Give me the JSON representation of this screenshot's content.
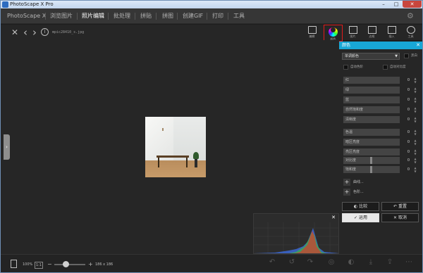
{
  "window": {
    "title": "PhotoScape X Pro",
    "min": "–",
    "max": "□",
    "close": "✕"
  },
  "menu": {
    "items": [
      "PhotoScape X",
      "浏览图片",
      "照片编辑",
      "批处理",
      "拼贴",
      "拼图",
      "创建GIF",
      "打印",
      "工具"
    ],
    "active_index": 2,
    "settings_icon": "gear-icon"
  },
  "toolbar": {
    "close_icon": "✕",
    "prev_icon": "‹",
    "next_icon": "›",
    "info_icon": "i",
    "filename": "mpic28410_s.jpg"
  },
  "right_tools": [
    {
      "label": "编辑",
      "icon": "edit-icon"
    },
    {
      "label": "颜色",
      "icon": "color-ring-icon",
      "selected": true
    },
    {
      "label": "图片",
      "icon": "image-icon"
    },
    {
      "label": "边框",
      "icon": "frame-icon"
    },
    {
      "label": "插入",
      "icon": "insert-icon"
    },
    {
      "label": "工具",
      "icon": "tools-icon"
    }
  ],
  "panel": {
    "title": "颜色",
    "close_icon": "✕",
    "mode_select": "单调颜色",
    "chk_mono": "黑白",
    "chk_auto_color": "自动色阶",
    "chk_auto_contrast": "自动对比度",
    "sliders": [
      {
        "label": "红",
        "value": "0"
      },
      {
        "label": "绿",
        "value": "0"
      },
      {
        "label": "蓝",
        "value": "0"
      },
      {
        "label": "自然饱和度",
        "value": "0"
      },
      {
        "label": "清晰度",
        "value": "0"
      },
      {
        "label": "色温",
        "value": "0"
      },
      {
        "label": "暗区亮度",
        "value": "0"
      },
      {
        "label": "亮区亮度",
        "value": "0"
      },
      {
        "label": "对比度",
        "value": "0"
      },
      {
        "label": "饱和度",
        "value": "0"
      }
    ],
    "add_curve": "曲线...",
    "add_levels": "色阶...",
    "compare_btn": "比较",
    "reset_btn": "重置",
    "apply_btn": "运用",
    "cancel_btn": "取消"
  },
  "histogram": {
    "close_icon": "✕",
    "colors": {
      "red": "#d83a2a",
      "green": "#3bb34a",
      "blue": "#3d6de0"
    }
  },
  "statusbar": {
    "zoom_percent": "100%",
    "fit_label": "1:1",
    "zoom_out": "−",
    "zoom_in": "+",
    "dimensions": "186 x 186",
    "zoom_level": 0.28
  }
}
